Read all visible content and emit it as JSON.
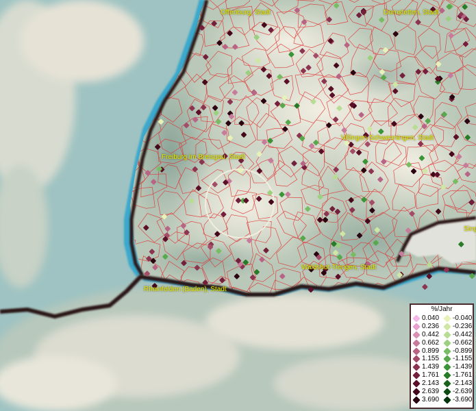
{
  "map": {
    "cities": [
      {
        "name": "Offenburg, Stadt"
      },
      {
        "name": "Dornstetten, Stadt"
      },
      {
        "name": "Villingen-Schwenningen, Stadt"
      },
      {
        "name": "Freiburg im Breisgau, Stadt"
      },
      {
        "name": "Waldshut-Tiengen, Stadt"
      },
      {
        "name": "Rheinfelden (Baden), Stadt"
      },
      {
        "name": "Sing"
      }
    ]
  },
  "legend": {
    "title": "%/Jahr",
    "rows": [
      {
        "pos": "0.040",
        "pos_color": "#f4b8e8",
        "neg": "-0.040",
        "neg_color": "#e6f2b8"
      },
      {
        "pos": "0.236",
        "pos_color": "#e8a0cc",
        "neg": "-0.236",
        "neg_color": "#cfe6a4"
      },
      {
        "pos": "0.442",
        "pos_color": "#d890b4",
        "neg": "-0.442",
        "neg_color": "#b8dc94"
      },
      {
        "pos": "0.662",
        "pos_color": "#c87c9c",
        "neg": "-0.662",
        "neg_color": "#9cd080"
      },
      {
        "pos": "0.899",
        "pos_color": "#b86484",
        "neg": "-0.899",
        "neg_color": "#78bc64"
      },
      {
        "pos": "1.155",
        "pos_color": "#a44c68",
        "neg": "-1.155",
        "neg_color": "#58a84c"
      },
      {
        "pos": "1.439",
        "pos_color": "#8c3450",
        "neg": "-1.439",
        "neg_color": "#3c9438"
      },
      {
        "pos": "1.761",
        "pos_color": "#74203c",
        "neg": "-1.761",
        "neg_color": "#287c28"
      },
      {
        "pos": "2.143",
        "pos_color": "#5c1028",
        "neg": "-2.143",
        "neg_color": "#18641c"
      },
      {
        "pos": "2.639",
        "pos_color": "#44081a",
        "neg": "-2.639",
        "neg_color": "#0c4c12"
      },
      {
        "pos": "3.690",
        "pos_color": "#2a0410",
        "neg": "-3.690",
        "neg_color": "#04340a"
      }
    ]
  },
  "colors": {
    "lake": "#9ec3c2",
    "border": "#2a1616",
    "admin_lines": "#e03030",
    "city_label": "#e8e800"
  }
}
